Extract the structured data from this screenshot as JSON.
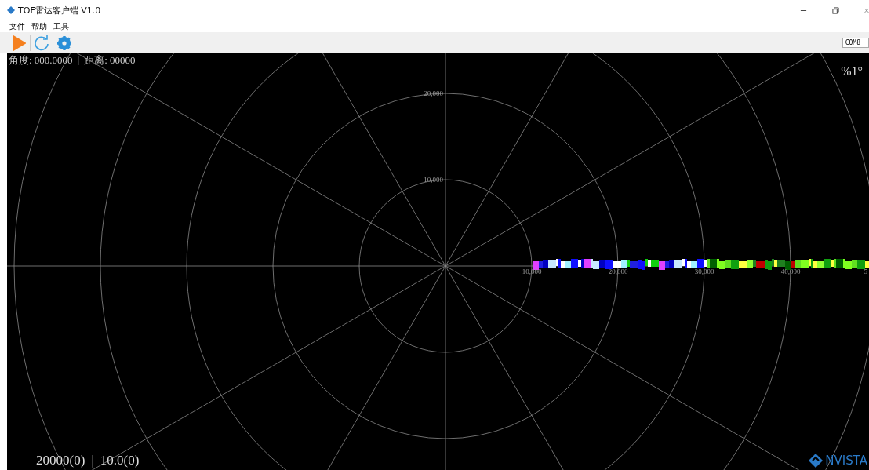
{
  "window": {
    "title": "TOF雷达客户端 V1.0"
  },
  "menu": [
    {
      "label": "文件"
    },
    {
      "label": "帮助"
    },
    {
      "label": "工具"
    }
  ],
  "toolbar": {
    "port": "COM8"
  },
  "readout": {
    "angle": "角度: 000.0000",
    "separator_top": "|",
    "distance": "距离: 00000",
    "corner": "%1°",
    "range": "20000(0)",
    "separator_bottom": "|",
    "speed": "10.0(0)"
  },
  "vertical_labels": [
    "20,000",
    "10,000"
  ],
  "horizontal_labels": [
    "10,000",
    "20,000",
    "30,000",
    "40,000",
    "5"
  ],
  "logo": "NVISTA"
}
